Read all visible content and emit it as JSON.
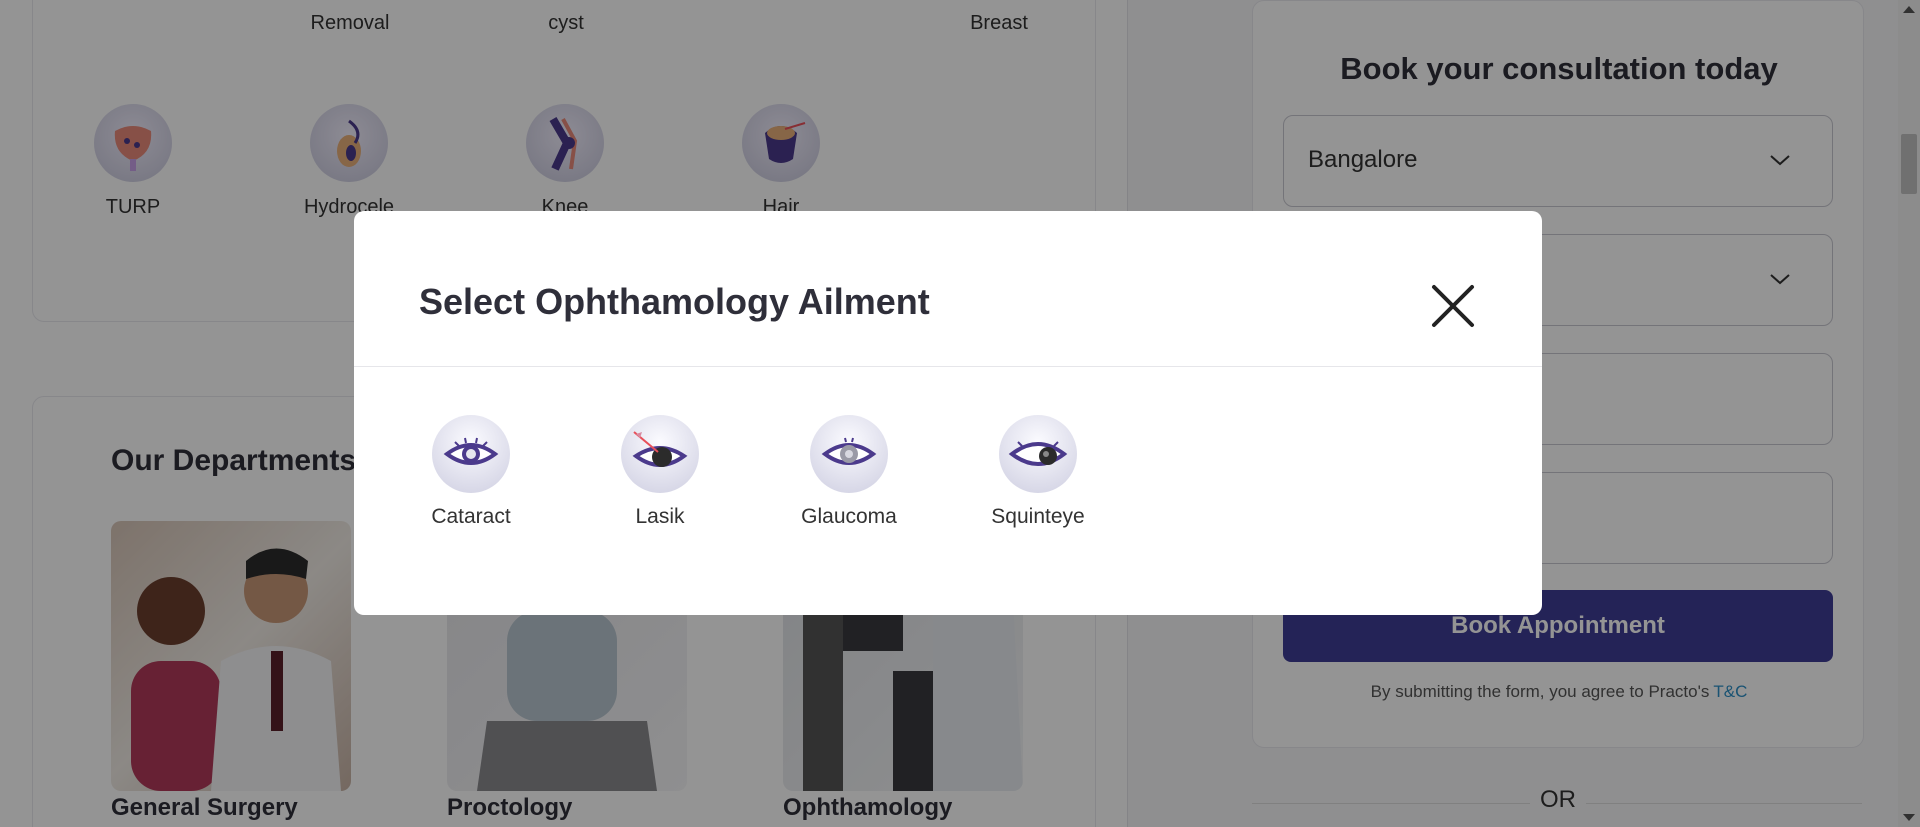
{
  "background": {
    "top_labels": [
      "Removal",
      "cyst",
      "Breast"
    ],
    "ailments": [
      {
        "label": "TURP",
        "icon": "turp-icon"
      },
      {
        "label": "Hydrocele",
        "icon": "hydrocele-icon"
      },
      {
        "label": "Knee",
        "icon": "knee-icon"
      },
      {
        "label": "Hair",
        "icon": "hair-icon"
      }
    ],
    "departments_title": "Our Departments",
    "departments": [
      "General Surgery",
      "Proctology",
      "Ophthamology"
    ]
  },
  "form": {
    "title": "Book your consultation today",
    "city_value": "Bangalore",
    "book_button": "Book Appointment",
    "terms_text": "By submitting the form, you agree to Practo's",
    "terms_link": "T&C",
    "or_text": "OR"
  },
  "modal": {
    "title": "Select Ophthamology Ailment",
    "options": [
      {
        "label": "Cataract",
        "icon": "cataract-icon"
      },
      {
        "label": "Lasik",
        "icon": "lasik-icon"
      },
      {
        "label": "Glaucoma",
        "icon": "glaucoma-icon"
      },
      {
        "label": "Squinteye",
        "icon": "squinteye-icon"
      }
    ]
  },
  "colors": {
    "accent": "#3f3d96",
    "link": "#2d8fc7",
    "icon_purple": "#4b3a8c"
  }
}
